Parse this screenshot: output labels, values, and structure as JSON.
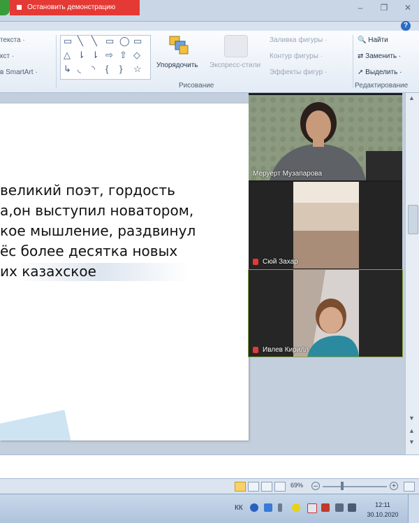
{
  "titlebar": {
    "stop_demo_label": "Остановить демонстрацию",
    "window_buttons": [
      "–",
      "❐",
      "✕"
    ],
    "help": "?"
  },
  "ribbon": {
    "text_left": [
      "текста ·",
      "кст ·",
      "в SmartArt ·"
    ],
    "arrange_label": "Упорядочить",
    "express_styles_label": "Экспресс-стили",
    "shape_fill": "Заливка фигуры ·",
    "shape_outline": "Контур фигуры ·",
    "shape_effects": "Эффекты фигур ·",
    "drawing_group": "Рисование",
    "find": "Найти",
    "replace": "Заменить ·",
    "select": "Выделить ·",
    "editing_group": "Редактирование",
    "shape_glyphs": [
      "▭",
      "╲",
      "╲",
      "▭",
      "◯",
      "▭",
      "△",
      "⇂",
      "⇂",
      "⇨",
      "⇧",
      "◇",
      "↳",
      "◟",
      "◝",
      "{",
      "}",
      "☆"
    ]
  },
  "slide": {
    "lines": [
      "великий поэт, гордость",
      "а,он выступил новатором,",
      "кое мышление, раздвинул",
      "ёс более десятка новых",
      "их казахское"
    ]
  },
  "participants": [
    {
      "name": "Меруерт Музапарова",
      "muted": false
    },
    {
      "name": "Сюй Захар",
      "muted": true
    },
    {
      "name": "Ивлев Кирилл",
      "muted": true
    }
  ],
  "statusbar": {
    "zoom": "69%",
    "zoom_minus": "–",
    "zoom_plus": "+"
  },
  "taskbar": {
    "lang": "КК",
    "time": "12:11",
    "date": "30.10.2020"
  },
  "colors": {
    "stop_button": "#e53935",
    "active_speaker_border": "#8aa63a",
    "video_bg": "#1d1d1d"
  }
}
